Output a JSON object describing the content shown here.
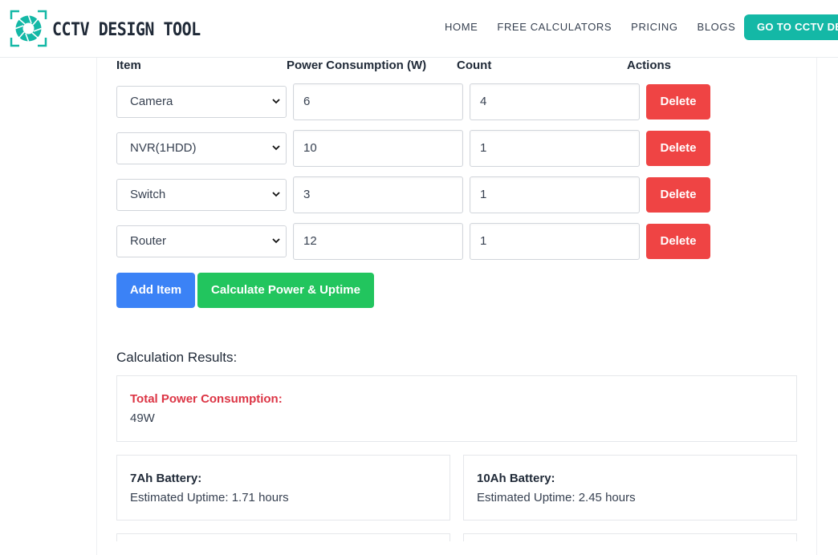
{
  "brand": {
    "name": "CCTV DESIGN TOOL"
  },
  "nav": {
    "items": [
      "HOME",
      "FREE CALCULATORS",
      "PRICING",
      "BLOGS"
    ],
    "cta": "GO TO CCTV DESIGN"
  },
  "table": {
    "headers": {
      "item": "Item",
      "power": "Power Consumption (W)",
      "count": "Count",
      "actions": "Actions"
    },
    "rows": [
      {
        "item": "Camera",
        "power": "6",
        "count": "4",
        "action": "Delete"
      },
      {
        "item": "NVR(1HDD)",
        "power": "10",
        "count": "1",
        "action": "Delete"
      },
      {
        "item": "Switch",
        "power": "3",
        "count": "1",
        "action": "Delete"
      },
      {
        "item": "Router",
        "power": "12",
        "count": "1",
        "action": "Delete"
      }
    ]
  },
  "buttons": {
    "add": "Add Item",
    "calculate": "Calculate Power & Uptime"
  },
  "results": {
    "title": "Calculation Results:",
    "total_label": "Total Power Consumption:",
    "total_value": "49W",
    "batteries": [
      {
        "label": "7Ah Battery:",
        "uptime": "Estimated Uptime: 1.71 hours"
      },
      {
        "label": "10Ah Battery:",
        "uptime": "Estimated Uptime: 2.45 hours"
      }
    ]
  },
  "colors": {
    "teal": "#14b8a6",
    "delete": "#ef4444",
    "add": "#3b82f6",
    "calculate": "#22c55e",
    "total_label": "#dc3545"
  }
}
